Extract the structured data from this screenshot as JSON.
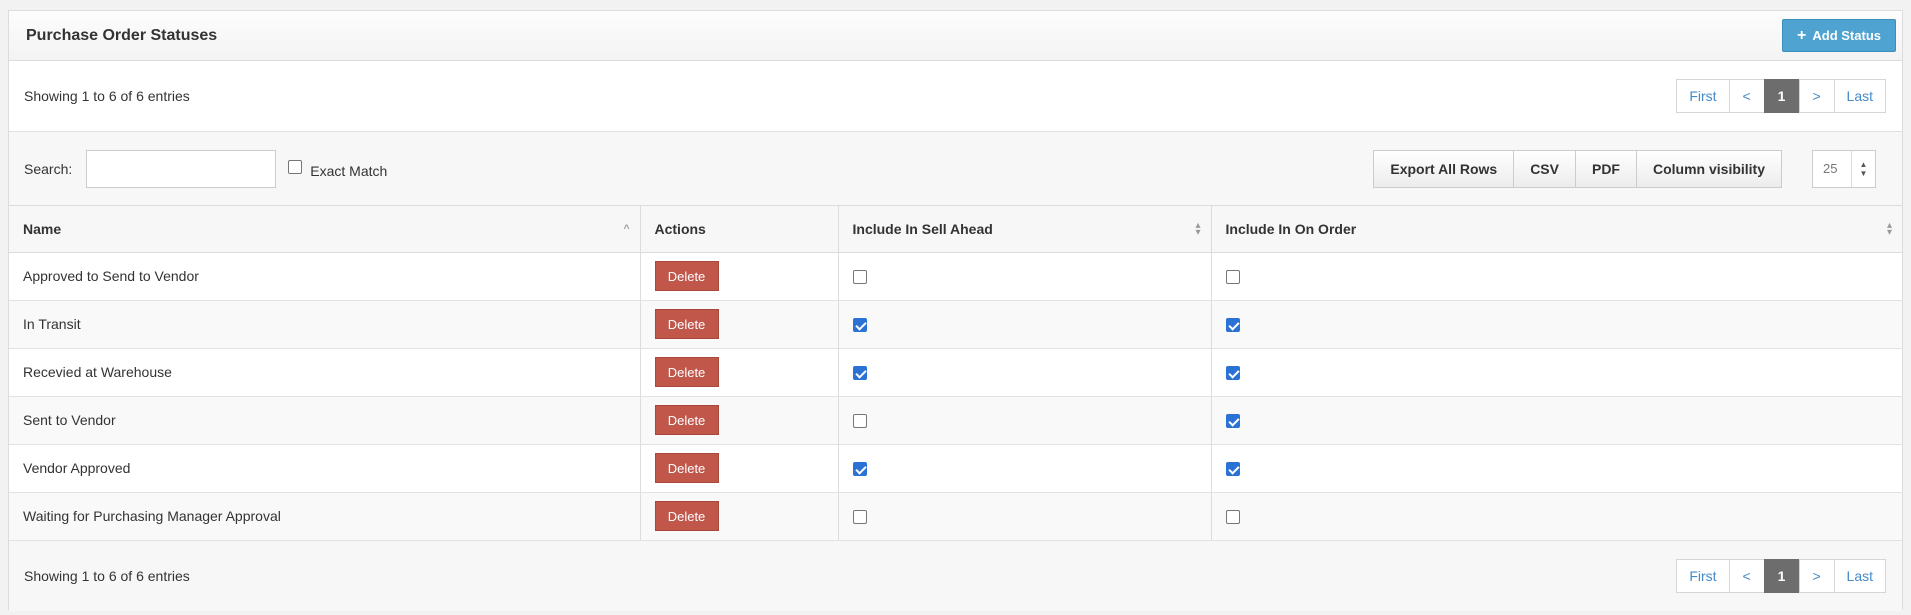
{
  "header": {
    "title": "Purchase Order Statuses",
    "add_button_label": "Add Status"
  },
  "info": {
    "showing_text": "Showing 1 to 6 of 6 entries"
  },
  "pagination": {
    "first": "First",
    "prev": "<",
    "current": "1",
    "next": ">",
    "last": "Last"
  },
  "toolbar": {
    "search_label": "Search:",
    "search_value": "",
    "exact_match_label": "Exact Match",
    "exact_match_checked": false,
    "export_label": "Export All Rows",
    "csv_label": "CSV",
    "pdf_label": "PDF",
    "column_visibility_label": "Column visibility",
    "page_length": "25"
  },
  "table": {
    "columns": [
      "Name",
      "Actions",
      "Include In Sell Ahead",
      "Include In On Order"
    ],
    "delete_label": "Delete",
    "rows": [
      {
        "name": "Approved to Send to Vendor",
        "sell_ahead": false,
        "on_order": false
      },
      {
        "name": "In Transit",
        "sell_ahead": true,
        "on_order": true
      },
      {
        "name": "Recevied at Warehouse",
        "sell_ahead": true,
        "on_order": true
      },
      {
        "name": "Sent to Vendor",
        "sell_ahead": false,
        "on_order": true
      },
      {
        "name": "Vendor Approved",
        "sell_ahead": true,
        "on_order": true
      },
      {
        "name": "Waiting for Purchasing Manager Approval",
        "sell_ahead": false,
        "on_order": false
      }
    ]
  },
  "colors": {
    "add_button": "#4fa3d1",
    "delete_button": "#c0574a",
    "checkbox_checked": "#2a72d4",
    "active_page": "#6d6d6d"
  }
}
